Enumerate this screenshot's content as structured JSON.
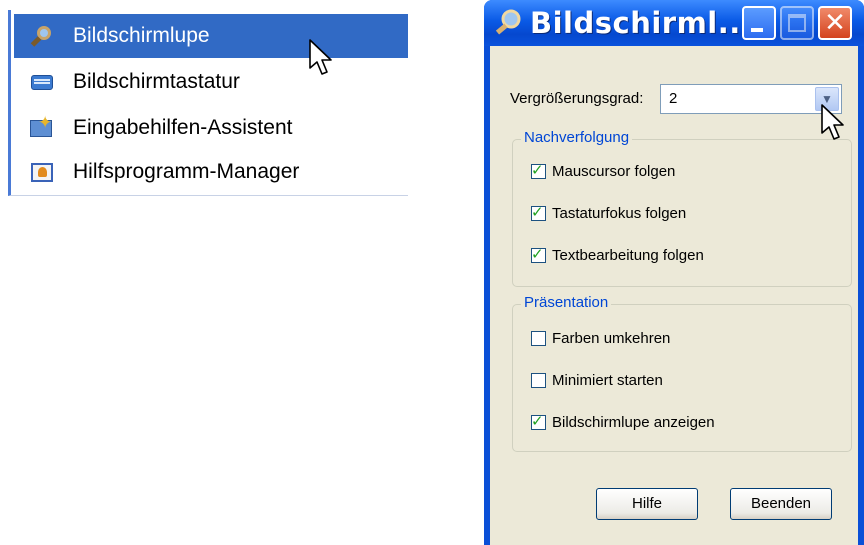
{
  "menu": {
    "items": [
      {
        "label": "Bildschirmlupe",
        "icon": "magnifier-icon",
        "selected": true
      },
      {
        "label": "Bildschirmtastatur",
        "icon": "keyboard-icon",
        "selected": false
      },
      {
        "label": "Eingabehilfen-Assistent",
        "icon": "accessibility-wizard-icon",
        "selected": false
      },
      {
        "label": "Hilfsprogramm-Manager",
        "icon": "utility-manager-icon",
        "selected": false
      }
    ],
    "selection_color": "#316ac5"
  },
  "dialog": {
    "title": "Bildschirml...",
    "titlebar_color": "#0a5ae6",
    "title_buttons": [
      "minimize",
      "maximize",
      "close"
    ],
    "zoom": {
      "label": "Vergrößerungsgrad:",
      "value": "2"
    },
    "tracking_group": {
      "title": "Nachverfolgung",
      "options": [
        {
          "label": "Mauscursor folgen",
          "checked": true
        },
        {
          "label": "Tastaturfokus folgen",
          "checked": true
        },
        {
          "label": "Textbearbeitung folgen",
          "checked": true
        }
      ]
    },
    "presentation_group": {
      "title": "Präsentation",
      "options": [
        {
          "label": "Farben umkehren",
          "checked": false
        },
        {
          "label": "Minimiert starten",
          "checked": false
        },
        {
          "label": "Bildschirmlupe anzeigen",
          "checked": true
        }
      ]
    },
    "buttons": {
      "help": "Hilfe",
      "exit": "Beenden"
    },
    "group_title_color": "#0046d5",
    "checkmark_color": "#21a121"
  }
}
